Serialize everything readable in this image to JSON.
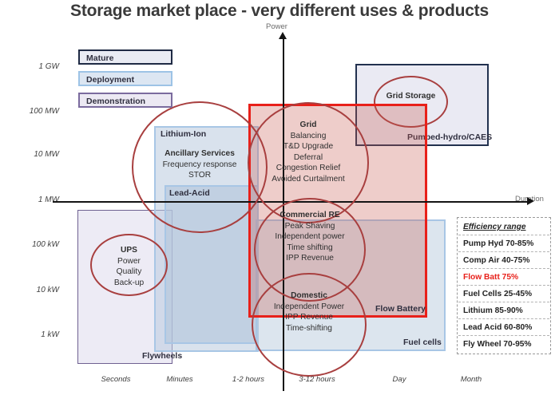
{
  "title": "Storage market place - very different uses & products",
  "axes": {
    "y_label": "Power",
    "x_label": "Duration",
    "y_ticks": [
      "1 GW",
      "100 MW",
      "10 MW",
      "1 MW",
      "100 kW",
      "10 kW",
      "1 kW"
    ],
    "x_ticks": [
      "Seconds",
      "Minutes",
      "1-2 hours",
      "3-12 hours",
      "Day",
      "Month"
    ]
  },
  "legend": {
    "items": [
      {
        "label": "Mature",
        "border": "#1f2a44",
        "fill": "#e9ebf3"
      },
      {
        "label": "Deployment",
        "border": "#9dc3e6",
        "fill": "#dce6f2"
      },
      {
        "label": "Demonstration",
        "border": "#7b6b9e",
        "fill": "#ece9f3"
      }
    ]
  },
  "technology_boxes": [
    {
      "label": "Flywheels",
      "category": "Demonstration",
      "color": "#6f6191"
    },
    {
      "label": "Lithium-Ion",
      "category": "Deployment",
      "color": "#a8c6e5"
    },
    {
      "label": "Lead-Acid",
      "category": "Deployment",
      "color": "#a8c6e5"
    },
    {
      "label": "Fuel cells",
      "category": "Deployment",
      "color": "#a8c6e5"
    },
    {
      "label": "Pumped-hydro/CAES",
      "category": "Mature",
      "color": "#22314f"
    },
    {
      "label": "Flow Battery",
      "category": "Highlight",
      "color": "#e8201a"
    }
  ],
  "application_bubbles": [
    {
      "name": "Ancillary Services",
      "lines": [
        "Frequency response",
        "STOR"
      ]
    },
    {
      "name": "Grid",
      "lines": [
        "Balancing",
        "T&D Upgrade",
        "Deferral",
        "Congestion Relief",
        "Avoided Curtailment"
      ]
    },
    {
      "name": "Commercial RE",
      "lines": [
        "Peak Shaving",
        "Independent power",
        "Time shifting",
        "IPP Revenue"
      ]
    },
    {
      "name": "Domestic",
      "lines": [
        "Independent Power",
        "IPP Revenue",
        "Time-shifting"
      ]
    },
    {
      "name": "UPS",
      "lines": [
        "Power",
        "Quality",
        "Back-up"
      ]
    },
    {
      "name": "Grid Storage",
      "lines": []
    }
  ],
  "efficiency_table": {
    "header": "Efficiency range",
    "rows": [
      {
        "label": "Pump Hyd 70-85%",
        "highlight": false
      },
      {
        "label": "Comp Air 40-75%",
        "highlight": false
      },
      {
        "label": "Flow Batt 75%",
        "highlight": true
      },
      {
        "label": "Fuel Cells 25-45%",
        "highlight": false
      },
      {
        "label": "Lithium 85-90%",
        "highlight": false
      },
      {
        "label": "Lead Acid 60-80%",
        "highlight": false
      },
      {
        "label": "Fly Wheel 70-95%",
        "highlight": false
      }
    ]
  },
  "chart_data": {
    "type": "scatter",
    "title": "Storage market place - very different uses & products",
    "xlabel": "Duration",
    "ylabel": "Power",
    "xticklabels": [
      "Seconds",
      "Minutes",
      "1-2 hours",
      "3-12 hours",
      "Day",
      "Month"
    ],
    "yticklabels": [
      "1 kW",
      "10 kW",
      "100 kW",
      "1 MW",
      "10 MW",
      "100 MW",
      "1 GW"
    ],
    "grid": false,
    "legend_position": "top-left",
    "regions": [
      {
        "name": "Flywheels",
        "category": "Demonstration",
        "x_range": [
          "Seconds",
          "Minutes"
        ],
        "y_range": [
          "1 kW",
          "1 MW"
        ]
      },
      {
        "name": "Lithium-Ion",
        "category": "Deployment",
        "x_range": [
          "Minutes",
          "1-2 hours"
        ],
        "y_range": [
          "1 kW",
          "10 MW"
        ]
      },
      {
        "name": "Lead-Acid",
        "category": "Deployment",
        "x_range": [
          "Minutes",
          "1-2 hours"
        ],
        "y_range": [
          "1 kW",
          "1 MW"
        ]
      },
      {
        "name": "Fuel cells",
        "category": "Deployment",
        "x_range": [
          "1-2 hours",
          "Day"
        ],
        "y_range": [
          "1 kW",
          "100 kW"
        ]
      },
      {
        "name": "Pumped-hydro/CAES",
        "category": "Mature",
        "x_range": [
          "3-12 hours",
          "Month"
        ],
        "y_range": [
          "10 MW",
          "1 GW"
        ]
      },
      {
        "name": "Flow Battery",
        "category": "Highlight",
        "x_range": [
          "1-2 hours",
          "Day"
        ],
        "y_range": [
          "1 kW",
          "100 MW"
        ]
      }
    ],
    "bubbles": [
      {
        "name": "Ancillary Services",
        "x": "Minutes",
        "y": "10 MW"
      },
      {
        "name": "Grid",
        "x": "1-2 hours",
        "y": "10 MW"
      },
      {
        "name": "Commercial RE",
        "x": "3-12 hours",
        "y": "100 kW"
      },
      {
        "name": "Domestic",
        "x": "3-12 hours",
        "y": "10 kW"
      },
      {
        "name": "UPS",
        "x": "Seconds",
        "y": "100 kW"
      },
      {
        "name": "Grid Storage",
        "x": "Day",
        "y": "100 MW"
      }
    ],
    "efficiency_ranges": [
      {
        "technology": "Pump Hyd",
        "min": 70,
        "max": 85
      },
      {
        "technology": "Comp Air",
        "min": 40,
        "max": 75
      },
      {
        "technology": "Flow Batt",
        "min": 75,
        "max": 75
      },
      {
        "technology": "Fuel Cells",
        "min": 25,
        "max": 45
      },
      {
        "technology": "Lithium",
        "min": 85,
        "max": 90
      },
      {
        "technology": "Lead Acid",
        "min": 60,
        "max": 80
      },
      {
        "technology": "Fly Wheel",
        "min": 70,
        "max": 95
      }
    ]
  }
}
